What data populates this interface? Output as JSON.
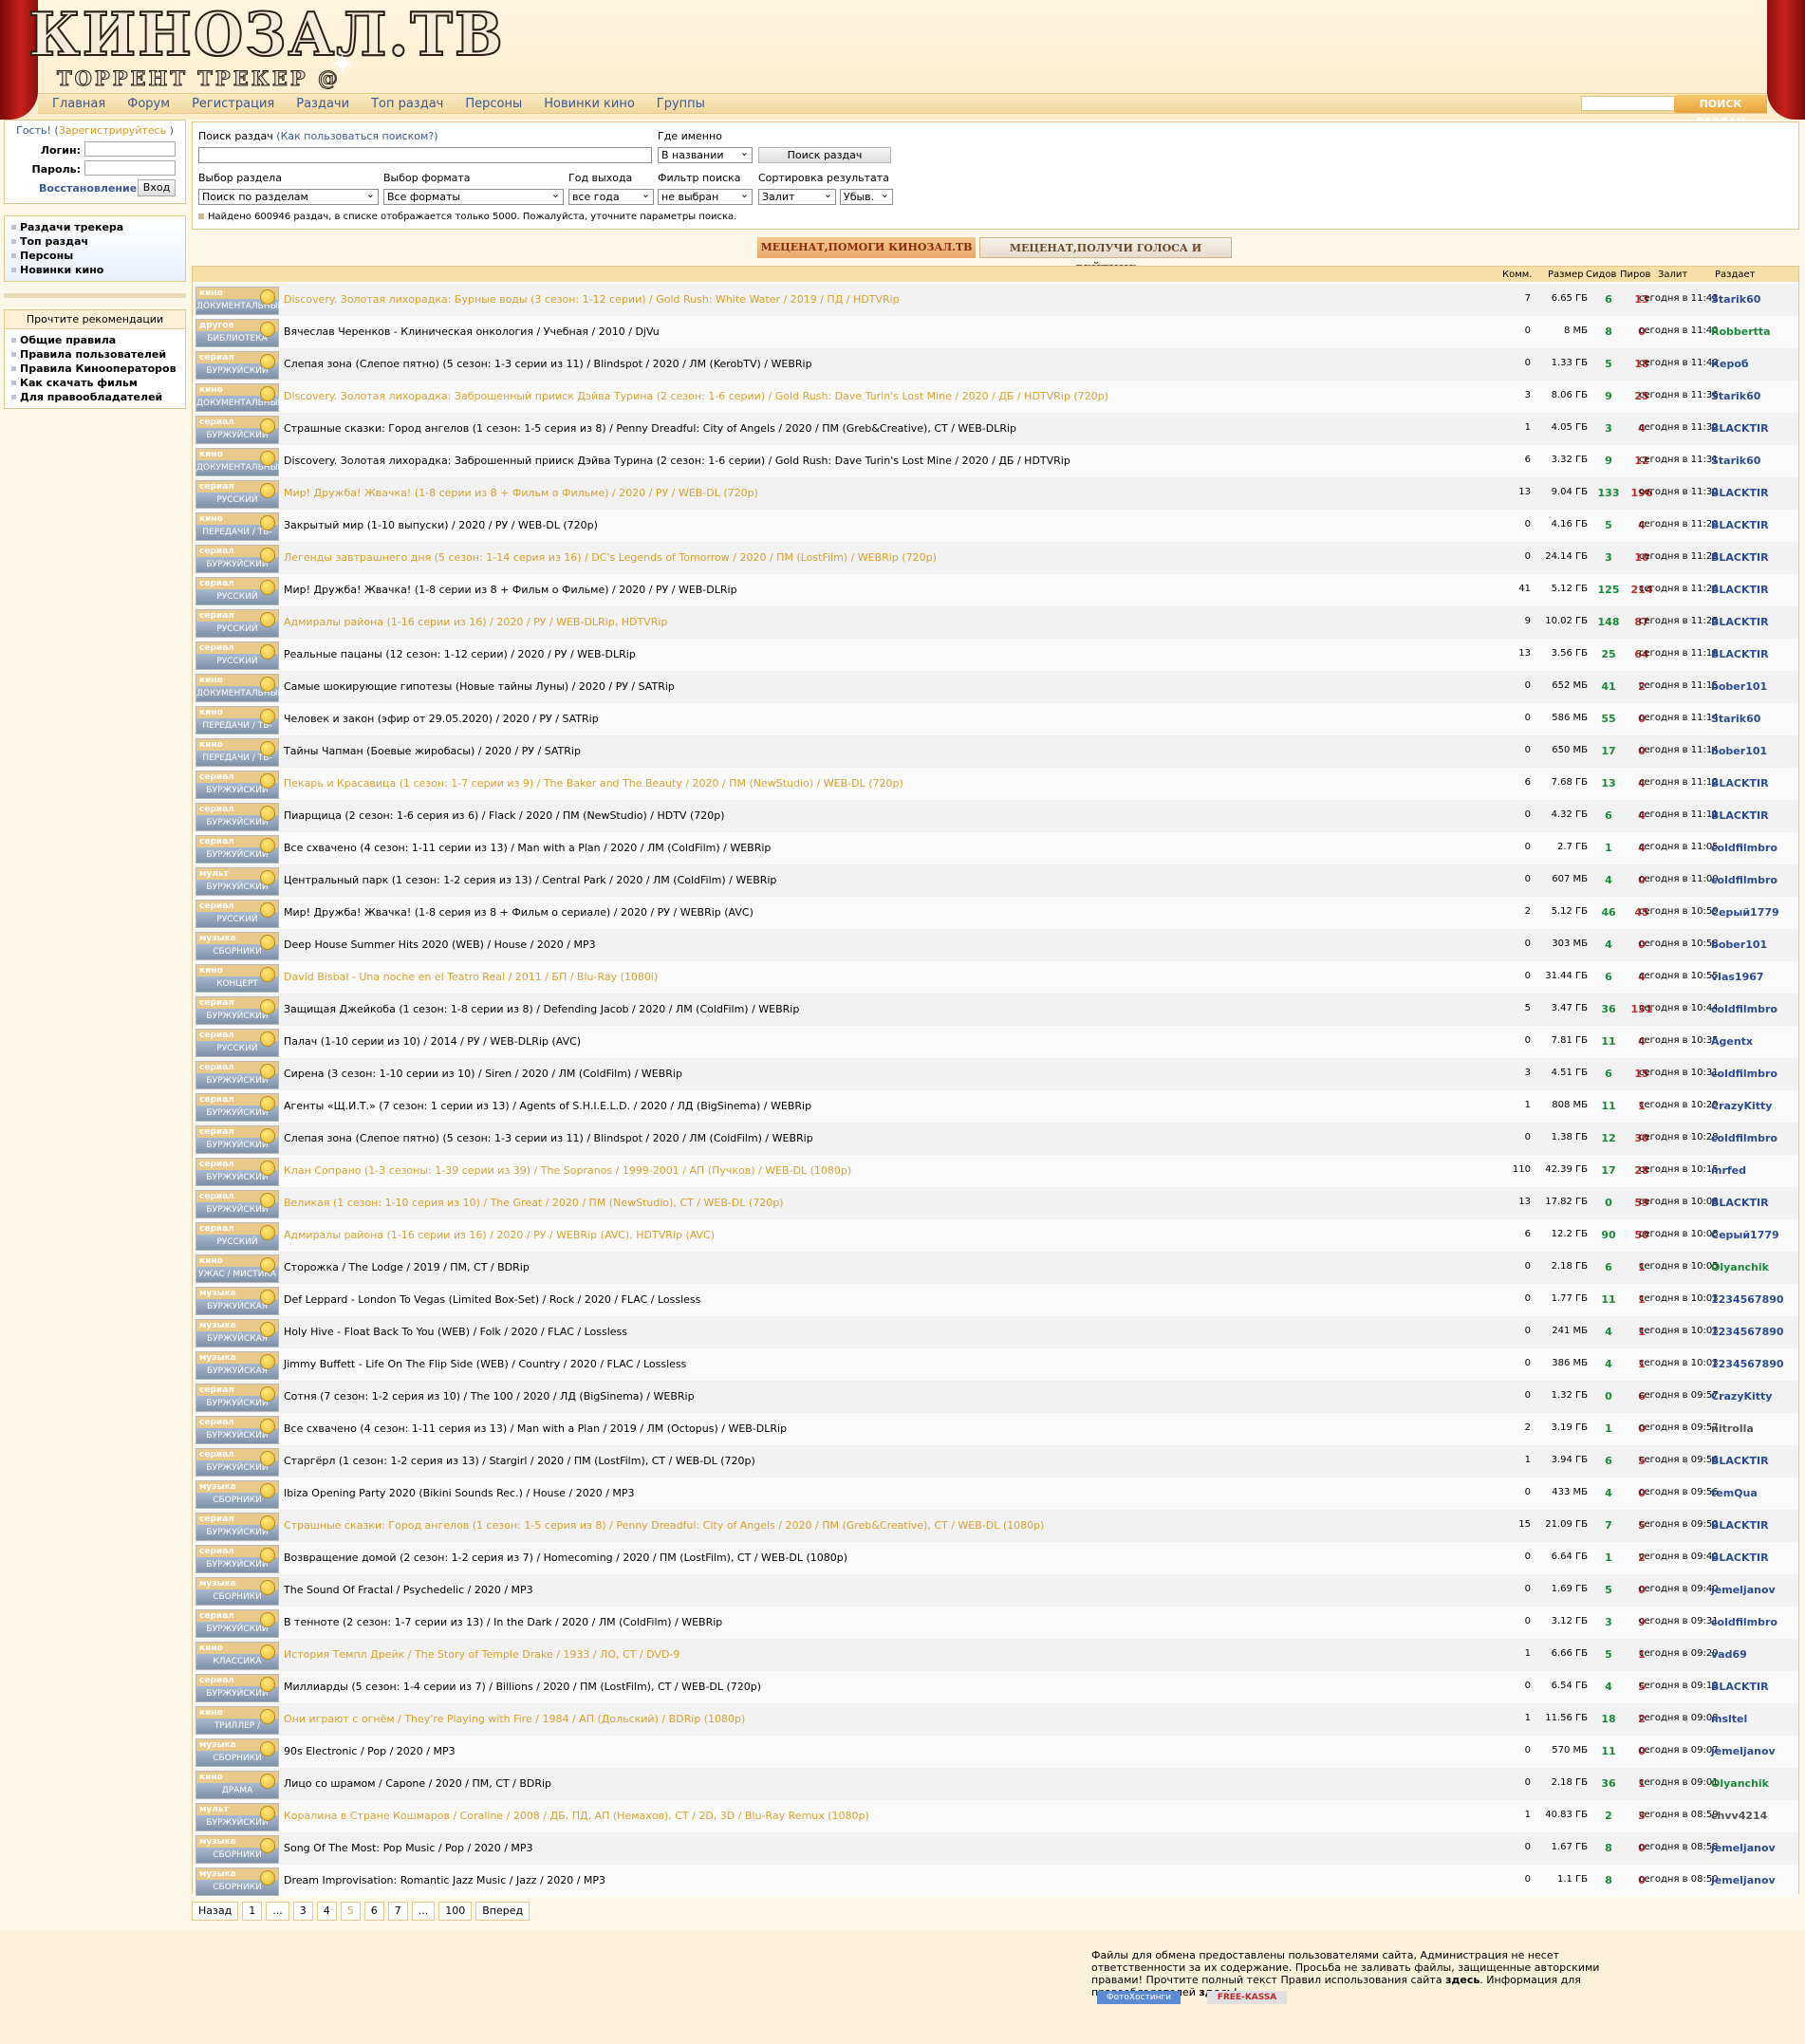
{
  "site": {
    "logo_big": "КИНОЗАЛ.ТВ",
    "logo_small": "ТОРРЕНТ ТРЕКЕР @"
  },
  "nav": [
    "Главная",
    "Форум",
    "Регистрация",
    "Раздачи",
    "Топ раздач",
    "Персоны",
    "Новинки кино",
    "Группы"
  ],
  "topsearch": {
    "button": "ПОИСК РАЗДАЧ"
  },
  "login": {
    "guest_prefix": "Гость! (",
    "register": "Зарегистрируйтесь",
    "guest_suffix": ")",
    "login_label": "Логин:",
    "password_label": "Пароль:",
    "restore": "Восстановление!",
    "submit": "Вход"
  },
  "sidebar": {
    "links": [
      "Раздачи трекера",
      "Топ раздач",
      "Персоны",
      "Новинки кино"
    ],
    "rec_title": "Прочтите рекомендации",
    "rec_links": [
      "Общие правила",
      "Правила пользователей",
      "Правила Кинооператоров",
      "Как скачать фильм",
      "Для правообладателей"
    ]
  },
  "search": {
    "label": "Поиск раздач",
    "hint_open": "(",
    "hint": "Как пользоваться поиском?",
    "hint_close": ")",
    "where_label": "Где именно",
    "where_value": "В названии",
    "button": "Поиск раздач",
    "section_label": "Выбор раздела",
    "section_value": "Поиск по разделам",
    "format_label": "Выбор формата",
    "format_value": "Все форматы",
    "year_label": "Год выхода",
    "year_value": "все года",
    "filter_label": "Фильтр поиска",
    "filter_value": "не выбран",
    "sort_label": "Сортировка результата",
    "sort_value": "Залит",
    "order_value": "Убыв.",
    "note": "Найдено 600946 раздач, в списке отображается только 5000. Пожалуйста, уточните параметры поиска."
  },
  "banners": [
    "МЕЦЕНАТ,ПОМОГИ КИНОЗАЛ.ТВ",
    "МЕЦЕНАТ,ПОЛУЧИ ГОЛОСА И РЕЙТИНГ"
  ],
  "table": {
    "headers": {
      "comm": "Комм.",
      "size": "Размер",
      "seeds": "Сидов",
      "peers": "Пиров",
      "date": "Залит",
      "user": "Раздает"
    },
    "rows": [
      {
        "t": "кино",
        "c": "ДОКУМЕНТАЛЬНЫЙ",
        "n": "Discovery. Золотая лихорадка: Бурные воды (3 сезон: 1-12 серии) / Gold Rush: White Water / 2019 / ПД / HDTVRip",
        "g": 1,
        "cm": "7",
        "s": "6.65 ГБ",
        "sd": "6",
        "p": "13",
        "d": "сегодня в 11:43",
        "u": "Starik60",
        "uc": ""
      },
      {
        "t": "другое",
        "c": "БИБЛИОТЕКА",
        "n": "Вячеслав Черенков - Клиническая онкология / Учебная / 2010 / DjVu",
        "g": 0,
        "cm": "0",
        "s": "8 МБ",
        "sd": "8",
        "p": "0",
        "d": "сегодня в 11:40",
        "u": "Robbertta",
        "uc": "green"
      },
      {
        "t": "сериал",
        "c": "БУРЖУЙСКИЙ",
        "n": "Слепая зона (Слепое пятно) (5 сезон: 1-3 серии из 11) / Blindspot / 2020 / ЛМ (KerobTV) / WEBRip",
        "g": 0,
        "cm": "0",
        "s": "1.33 ГБ",
        "sd": "5",
        "p": "18",
        "d": "сегодня в 11:40",
        "u": "Кероб",
        "uc": ""
      },
      {
        "t": "кино",
        "c": "ДОКУМЕНТАЛЬНЫЙ",
        "n": "Discovery. Золотая лихорадка: Заброшенный прииск Дэйва Турина (2 сезон: 1-6 серии) / Gold Rush: Dave Turin's Lost Mine / 2020 / ДБ / HDTVRip (720p)",
        "g": 1,
        "cm": "3",
        "s": "8.06 ГБ",
        "sd": "9",
        "p": "25",
        "d": "сегодня в 11:36",
        "u": "Starik60",
        "uc": ""
      },
      {
        "t": "сериал",
        "c": "БУРЖУЙСКИЙ",
        "n": "Страшные сказки: Город ангелов (1 сезон: 1-5 серия из 8) / Penny Dreadful: City of Angels / 2020 / ПМ (Greb&Creative), СТ / WEB-DLRip",
        "g": 0,
        "cm": "1",
        "s": "4.05 ГБ",
        "sd": "3",
        "p": "4",
        "d": "сегодня в 11:32",
        "u": "BLACKTIR",
        "uc": ""
      },
      {
        "t": "кино",
        "c": "ДОКУМЕНТАЛЬНЫЙ",
        "n": "Discovery. Золотая лихорадка: Заброшенный прииск Дэйва Турина (2 сезон: 1-6 серии) / Gold Rush: Dave Turin's Lost Mine / 2020 / ДБ / HDTVRip",
        "g": 0,
        "cm": "6",
        "s": "3.32 ГБ",
        "sd": "9",
        "p": "12",
        "d": "сегодня в 11:31",
        "u": "Starik60",
        "uc": ""
      },
      {
        "t": "сериал",
        "c": "РУССКИЙ",
        "n": "Мир! Дружба! Жвачка! (1-8 серии из 8 + Фильм о Фильме) / 2020 / РУ / WEB-DL (720p)",
        "g": 1,
        "cm": "13",
        "s": "9.04 ГБ",
        "sd": "133",
        "p": "196",
        "d": "сегодня в 11:30",
        "u": "BLACKTIR",
        "uc": ""
      },
      {
        "t": "кино",
        "c": "ПЕРЕДАЧИ / ТВ-ШОУ",
        "n": "Закрытый мир (1-10 выпуски) / 2020 / РУ / WEB-DL (720p)",
        "g": 0,
        "cm": "0",
        "s": "4.16 ГБ",
        "sd": "5",
        "p": "4",
        "d": "сегодня в 11:29",
        "u": "BLACKTIR",
        "uc": ""
      },
      {
        "t": "сериал",
        "c": "БУРЖУЙСКИЙ",
        "n": "Легенды завтрашнего дня (5 сезон: 1-14 серия из 16) / DC's Legends of Tomorrow / 2020 / ПМ (LostFilm) / WEBRip (720p)",
        "g": 1,
        "cm": "0",
        "s": "24.14 ГБ",
        "sd": "3",
        "p": "10",
        "d": "сегодня в 11:28",
        "u": "BLACKTIR",
        "uc": ""
      },
      {
        "t": "сериал",
        "c": "РУССКИЙ",
        "n": "Мир! Дружба! Жвачка! (1-8 серии из 8 + Фильм о Фильме) / 2020 / РУ / WEB-DLRip",
        "g": 0,
        "cm": "41",
        "s": "5.12 ГБ",
        "sd": "125",
        "p": "214",
        "d": "сегодня в 11:26",
        "u": "BLACKTIR",
        "uc": ""
      },
      {
        "t": "сериал",
        "c": "РУССКИЙ",
        "n": "Адмиралы района (1-16 серии из 16) / 2020 / РУ / WEB-DLRip, HDTVRip",
        "g": 1,
        "cm": "9",
        "s": "10.02 ГБ",
        "sd": "148",
        "p": "87",
        "d": "сегодня в 11:25",
        "u": "BLACKTIR",
        "uc": ""
      },
      {
        "t": "сериал",
        "c": "РУССКИЙ",
        "n": "Реальные пацаны (12 сезон: 1-12 серии) / 2020 / РУ / WEB-DLRip",
        "g": 0,
        "cm": "13",
        "s": "3.56 ГБ",
        "sd": "25",
        "p": "64",
        "d": "сегодня в 11:18",
        "u": "BLACKTIR",
        "uc": ""
      },
      {
        "t": "кино",
        "c": "ДОКУМЕНТАЛЬНЫЙ",
        "n": "Самые шокирующие гипотезы (Новые тайны Луны) / 2020 / РУ / SATRip",
        "g": 0,
        "cm": "0",
        "s": "652 МБ",
        "sd": "41",
        "p": "2",
        "d": "сегодня в 11:15",
        "u": "bober101",
        "uc": ""
      },
      {
        "t": "кино",
        "c": "ПЕРЕДАЧИ / ТВ-ШОУ",
        "n": "Человек и закон (эфир от 29.05.2020) / 2020 / РУ / SATRip",
        "g": 0,
        "cm": "0",
        "s": "586 МБ",
        "sd": "55",
        "p": "0",
        "d": "сегодня в 11:14",
        "u": "Starik60",
        "uc": ""
      },
      {
        "t": "кино",
        "c": "ПЕРЕДАЧИ / ТВ-ШОУ",
        "n": "Тайны Чапман (Боевые жиробасы) / 2020 / РУ / SATRip",
        "g": 0,
        "cm": "0",
        "s": "650 МБ",
        "sd": "17",
        "p": "0",
        "d": "сегодня в 11:14",
        "u": "bober101",
        "uc": ""
      },
      {
        "t": "сериал",
        "c": "БУРЖУЙСКИЙ",
        "n": "Пекарь и Красавица (1 сезон: 1-7 серии из 9) / The Baker and The Beauty / 2020 / ПМ (NewStudio) / WEB-DL (720p)",
        "g": 1,
        "cm": "6",
        "s": "7.68 ГБ",
        "sd": "13",
        "p": "4",
        "d": "сегодня в 11:12",
        "u": "BLACKTIR",
        "uc": ""
      },
      {
        "t": "сериал",
        "c": "БУРЖУЙСКИЙ",
        "n": "Пиарщица (2 сезон: 1-6 серия из 6) / Flack / 2020 / ПМ (NewStudio) / HDTV (720p)",
        "g": 0,
        "cm": "0",
        "s": "4.32 ГБ",
        "sd": "6",
        "p": "4",
        "d": "сегодня в 11:11",
        "u": "BLACKTIR",
        "uc": ""
      },
      {
        "t": "сериал",
        "c": "БУРЖУЙСКИЙ",
        "n": "Все схвачено (4 сезон: 1-11 серии из 13) / Man with a Plan / 2020 / ЛМ (ColdFilm) / WEBRip",
        "g": 0,
        "cm": "0",
        "s": "2.7 ГБ",
        "sd": "1",
        "p": "4",
        "d": "сегодня в 11:05",
        "u": "coldfilmbro",
        "uc": ""
      },
      {
        "t": "мульт",
        "c": "БУРЖУЙСКИЙ",
        "n": "Центральный парк (1 сезон: 1-2 серия из 13) / Central Park / 2020 / ЛМ (ColdFilm) / WEBRip",
        "g": 0,
        "cm": "0",
        "s": "607 МБ",
        "sd": "4",
        "p": "0",
        "d": "сегодня в 11:00",
        "u": "coldfilmbro",
        "uc": ""
      },
      {
        "t": "сериал",
        "c": "РУССКИЙ",
        "n": "Мир! Дружба! Жвачка! (1-8 серия из 8 + Фильм о сериале) / 2020 / РУ / WEBRip (AVC)",
        "g": 0,
        "cm": "2",
        "s": "5.12 ГБ",
        "sd": "46",
        "p": "45",
        "d": "сегодня в 10:59",
        "u": "Серый1779",
        "uc": ""
      },
      {
        "t": "музыка",
        "c": "СБОРНИКИ",
        "n": "Deep House Summer Hits 2020 (WEB) / House / 2020 / MP3",
        "g": 0,
        "cm": "0",
        "s": "303 МБ",
        "sd": "4",
        "p": "0",
        "d": "сегодня в 10:58",
        "u": "bober101",
        "uc": ""
      },
      {
        "t": "кино",
        "c": "КОНЦЕРТ",
        "n": "David Bisbal - Una noche en el Teatro Real / 2011 / БП / Blu-Ray (1080i)",
        "g": 1,
        "cm": "0",
        "s": "31.44 ГБ",
        "sd": "6",
        "p": "4",
        "d": "сегодня в 10:55",
        "u": "vlas1967",
        "uc": ""
      },
      {
        "t": "сериал",
        "c": "БУРЖУЙСКИЙ",
        "n": "Защищая Джейкоба (1 сезон: 1-8 серии из 8) / Defending Jacob / 2020 / ЛМ (ColdFilm) / WEBRip",
        "g": 0,
        "cm": "5",
        "s": "3.47 ГБ",
        "sd": "36",
        "p": "131",
        "d": "сегодня в 10:44",
        "u": "coldfilmbro",
        "uc": ""
      },
      {
        "t": "сериал",
        "c": "РУССКИЙ",
        "n": "Палач (1-10 серии из 10) / 2014 / РУ / WEB-DLRip (AVC)",
        "g": 0,
        "cm": "0",
        "s": "7.81 ГБ",
        "sd": "11",
        "p": "4",
        "d": "сегодня в 10:35",
        "u": "Agentx",
        "uc": ""
      },
      {
        "t": "сериал",
        "c": "БУРЖУЙСКИЙ",
        "n": "Сирена (3 сезон: 1-10 серии из 10) / Siren / 2020 / ЛМ (ColdFilm) / WEBRip",
        "g": 0,
        "cm": "3",
        "s": "4.51 ГБ",
        "sd": "6",
        "p": "15",
        "d": "сегодня в 10:31",
        "u": "coldfilmbro",
        "uc": ""
      },
      {
        "t": "сериал",
        "c": "БУРЖУЙСКИЙ",
        "n": "Агенты «Щ.И.Т.» (7 сезон: 1 серии из 13) / Agents of S.H.I.E.L.D. / 2020 / ЛД (BigSinema) / WEBRip",
        "g": 0,
        "cm": "1",
        "s": "808 МБ",
        "sd": "11",
        "p": "1",
        "d": "сегодня в 10:29",
        "u": "CrazyKitty",
        "uc": ""
      },
      {
        "t": "сериал",
        "c": "БУРЖУЙСКИЙ",
        "n": "Слепая зона (Слепое пятно) (5 сезон: 1-3 серии из 11) / Blindspot / 2020 / ЛМ (ColdFilm) / WEBRip",
        "g": 0,
        "cm": "0",
        "s": "1.38 ГБ",
        "sd": "12",
        "p": "30",
        "d": "сегодня в 10:28",
        "u": "coldfilmbro",
        "uc": ""
      },
      {
        "t": "сериал",
        "c": "БУРЖУЙСКИЙ",
        "n": "Клан Сопрано (1-3 сезоны: 1-39 серии из 39) / The Sopranos / 1999-2001 / АП (Пучков) / WEB-DL (1080p)",
        "g": 1,
        "cm": "110",
        "s": "42.39 ГБ",
        "sd": "17",
        "p": "28",
        "d": "сегодня в 10:15",
        "u": "mrfed",
        "uc": ""
      },
      {
        "t": "сериал",
        "c": "БУРЖУЙСКИЙ",
        "n": "Великая (1 сезон: 1-10 серия из 10) / The Great / 2020 / ПМ (NewStudio), СТ / WEB-DL (720p)",
        "g": 1,
        "cm": "13",
        "s": "17.82 ГБ",
        "sd": "0",
        "p": "59",
        "d": "сегодня в 10:08",
        "u": "BLACKTIR",
        "uc": ""
      },
      {
        "t": "сериал",
        "c": "РУССКИЙ",
        "n": "Адмиралы района (1-16 серии из 16) / 2020 / РУ / WEBRip (AVC), HDTVRip (AVC)",
        "g": 1,
        "cm": "6",
        "s": "12.2 ГБ",
        "sd": "90",
        "p": "50",
        "d": "сегодня в 10:08",
        "u": "Серый1779",
        "uc": ""
      },
      {
        "t": "кино",
        "c": "УЖАС / МИСТИКА",
        "n": "Сторожка / The Lodge / 2019 / ПМ, СТ / BDRip",
        "g": 0,
        "cm": "0",
        "s": "2.18 ГБ",
        "sd": "6",
        "p": "1",
        "d": "сегодня в 10:05",
        "u": "Olyanchik",
        "uc": "green"
      },
      {
        "t": "музыка",
        "c": "БУРЖУЙСКАЯ",
        "n": "Def Leppard - London To Vegas (Limited Box-Set) / Rock / 2020 / FLAC / Lossless",
        "g": 0,
        "cm": "0",
        "s": "1.77 ГБ",
        "sd": "11",
        "p": "1",
        "d": "сегодня в 10:03",
        "u": "1234567890",
        "uc": ""
      },
      {
        "t": "музыка",
        "c": "БУРЖУЙСКАЯ",
        "n": "Holy Hive - Float Back To You (WEB) / Folk / 2020 / FLAC / Lossless",
        "g": 0,
        "cm": "0",
        "s": "241 МБ",
        "sd": "4",
        "p": "1",
        "d": "сегодня в 10:03",
        "u": "1234567890",
        "uc": ""
      },
      {
        "t": "музыка",
        "c": "БУРЖУЙСКАЯ",
        "n": "Jimmy Buffett - Life On The Flip Side (WEB) / Country / 2020 / FLAC / Lossless",
        "g": 0,
        "cm": "0",
        "s": "386 МБ",
        "sd": "4",
        "p": "1",
        "d": "сегодня в 10:03",
        "u": "1234567890",
        "uc": ""
      },
      {
        "t": "сериал",
        "c": "БУРЖУЙСКИЙ",
        "n": "Сотня (7 сезон: 1-2 серия из 10) / The 100 / 2020 / ЛД (BigSinema) / WEBRip",
        "g": 0,
        "cm": "0",
        "s": "1.32 ГБ",
        "sd": "0",
        "p": "6",
        "d": "сегодня в 09:57",
        "u": "CrazyKitty",
        "uc": ""
      },
      {
        "t": "сериал",
        "c": "БУРЖУЙСКИЙ",
        "n": "Все схвачено (4 сезон: 1-11 серия из 13) / Man with a Plan / 2019 / ЛМ (Octopus) / WEB-DLRip",
        "g": 0,
        "cm": "2",
        "s": "3.19 ГБ",
        "sd": "1",
        "p": "0",
        "d": "сегодня в 09:57",
        "u": "nitrolla",
        "uc": "gray"
      },
      {
        "t": "сериал",
        "c": "БУРЖУЙСКИЙ",
        "n": "Старгёрл (1 сезон: 1-2 серия из 13) / Stargirl / 2020 / ПМ (LostFilm), СТ / WEB-DL (720p)",
        "g": 0,
        "cm": "1",
        "s": "3.94 ГБ",
        "sd": "6",
        "p": "5",
        "d": "сегодня в 09:56",
        "u": "BLACKTIR",
        "uc": ""
      },
      {
        "t": "музыка",
        "c": "СБОРНИКИ",
        "n": "Ibiza Opening Party 2020 (Bikini Sounds Rec.) / House / 2020 / MP3",
        "g": 0,
        "cm": "0",
        "s": "433 МБ",
        "sd": "4",
        "p": "0",
        "d": "сегодня в 09:56",
        "u": "temQua",
        "uc": ""
      },
      {
        "t": "сериал",
        "c": "БУРЖУЙСКИЙ",
        "n": "Страшные сказки: Город ангелов (1 сезон: 1-5 серия из 8) / Penny Dreadful: City of Angels / 2020 / ПМ (Greb&Creative), СТ / WEB-DL (1080p)",
        "g": 1,
        "cm": "15",
        "s": "21.09 ГБ",
        "sd": "7",
        "p": "5",
        "d": "сегодня в 09:50",
        "u": "BLACKTIR",
        "uc": ""
      },
      {
        "t": "сериал",
        "c": "БУРЖУЙСКИЙ",
        "n": "Возвращение домой (2 сезон: 1-2 серия из 7) / Homecoming / 2020 / ПМ (LostFilm), СТ / WEB-DL (1080p)",
        "g": 0,
        "cm": "0",
        "s": "6.64 ГБ",
        "sd": "1",
        "p": "2",
        "d": "сегодня в 09:40",
        "u": "BLACKTIR",
        "uc": ""
      },
      {
        "t": "музыка",
        "c": "СБОРНИКИ",
        "n": "The Sound Of Fractal / Psychedelic / 2020 / MP3",
        "g": 0,
        "cm": "0",
        "s": "1.69 ГБ",
        "sd": "5",
        "p": "0",
        "d": "сегодня в 09:40",
        "u": "jemeljanov",
        "uc": ""
      },
      {
        "t": "сериал",
        "c": "БУРЖУЙСКИЙ",
        "n": "В тенноте (2 сезон: 1-7 серии из 13) / In the Dark / 2020 / ЛМ (ColdFilm) / WEBRip",
        "g": 0,
        "cm": "0",
        "s": "3.12 ГБ",
        "sd": "3",
        "p": "9",
        "d": "сегодня в 09:31",
        "u": "coldfilmbro",
        "uc": ""
      },
      {
        "t": "кино",
        "c": "КЛАССИКА",
        "n": "История Темпл Дрейк / The Story of Temple Drake / 1933 / ЛО, СТ / DVD-9",
        "g": 1,
        "cm": "1",
        "s": "6.66 ГБ",
        "sd": "5",
        "p": "1",
        "d": "сегодня в 09:29",
        "u": "vad69",
        "uc": ""
      },
      {
        "t": "сериал",
        "c": "БУРЖУЙСКИЙ",
        "n": "Миллиарды (5 сезон: 1-4 серии из 7) / Billions / 2020 / ПМ (LostFilm), СТ / WEB-DL (720p)",
        "g": 0,
        "cm": "0",
        "s": "6.54 ГБ",
        "sd": "4",
        "p": "5",
        "d": "сегодня в 09:19",
        "u": "BLACKTIR",
        "uc": ""
      },
      {
        "t": "кино",
        "c": "ТРИЛЛЕР / ДЕТЕКТИВ",
        "n": "Они играют с огнём / They're Playing with Fire / 1984 / АП (Дольский) / BDRip (1080p)",
        "g": 1,
        "cm": "1",
        "s": "11.56 ГБ",
        "sd": "18",
        "p": "2",
        "d": "сегодня в 09:08",
        "u": "msltel",
        "uc": ""
      },
      {
        "t": "музыка",
        "c": "СБОРНИКИ",
        "n": "90s Electronic / Pop / 2020 / MP3",
        "g": 0,
        "cm": "0",
        "s": "570 МБ",
        "sd": "11",
        "p": "0",
        "d": "сегодня в 09:07",
        "u": "jemeljanov",
        "uc": ""
      },
      {
        "t": "кино",
        "c": "ДРАМА",
        "n": "Лицо со шрамом / Capone / 2020 / ПМ, СТ / BDRip",
        "g": 0,
        "cm": "0",
        "s": "2.18 ГБ",
        "sd": "36",
        "p": "1",
        "d": "сегодня в 09:01",
        "u": "Olyanchik",
        "uc": "green"
      },
      {
        "t": "мульт",
        "c": "БУРЖУЙСКИЙ",
        "n": "Коралина в Стране Кошмаров / Coraline / 2008 / ДБ, ПД, АП (Немахов), СТ / 2D, 3D / Blu-Ray Remux (1080p)",
        "g": 1,
        "cm": "1",
        "s": "40.83 ГБ",
        "sd": "2",
        "p": "3",
        "d": "сегодня в 08:59",
        "u": "chvv4214",
        "uc": "gray"
      },
      {
        "t": "музыка",
        "c": "СБОРНИКИ",
        "n": "Song Of The Most: Pop Music / Pop / 2020 / MP3",
        "g": 0,
        "cm": "0",
        "s": "1.67 ГБ",
        "sd": "8",
        "p": "0",
        "d": "сегодня в 08:58",
        "u": "jemeljanov",
        "uc": ""
      },
      {
        "t": "музыка",
        "c": "СБОРНИКИ",
        "n": "Dream Improvisation: Romantic Jazz Music / Jazz / 2020 / MP3",
        "g": 0,
        "cm": "0",
        "s": "1.1 ГБ",
        "sd": "8",
        "p": "0",
        "d": "сегодня в 08:50",
        "u": "jemeljanov",
        "uc": ""
      }
    ]
  },
  "pager": [
    "Назад",
    "1",
    "...",
    "3",
    "4",
    "5",
    "6",
    "7",
    "...",
    "100",
    "Вперед"
  ],
  "footer": {
    "text1": "Файлы для обмена предоставлены пользователями сайта, Администрация не несет ответственности за их содержание. Просьба не заливать файлы, защищенные авторскими правами! Прочтите полный текст Правил использования сайта ",
    "here1": "здесь",
    "text2": ". Информация для правообладателей ",
    "here2": "здесь",
    "text3": "!",
    "badge1": "ФотоХостинги",
    "badge2": "FREE-KASSA"
  }
}
